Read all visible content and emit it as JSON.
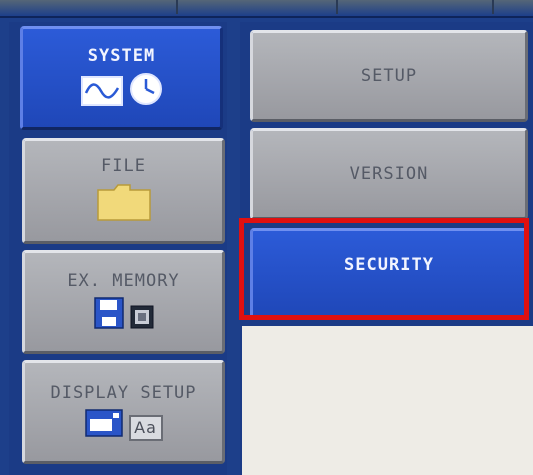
{
  "menu": {
    "items": [
      {
        "label": "SYSTEM",
        "icons": [
          "waveform-monitor-icon",
          "clock-icon"
        ],
        "selected": true
      },
      {
        "label": "FILE",
        "icons": [
          "folder-icon"
        ]
      },
      {
        "label": "EX. MEMORY",
        "icons": [
          "floppy-disk-icon",
          "memory-card-icon"
        ]
      },
      {
        "label": "DISPLAY SETUP",
        "icons": [
          "display-window-icon",
          "font-aa-icon"
        ],
        "icon_text": "Aa"
      }
    ]
  },
  "submenu": {
    "items": [
      {
        "label": "SETUP"
      },
      {
        "label": "VERSION"
      },
      {
        "label": "SECURITY",
        "selected": true
      }
    ]
  },
  "colors": {
    "background_blue": "#1d3f8a",
    "selected_blue": "#2c5bd8",
    "button_gray": "#a9abb0",
    "highlight_red": "#e01010",
    "folder_yellow": "#f1d97a"
  }
}
